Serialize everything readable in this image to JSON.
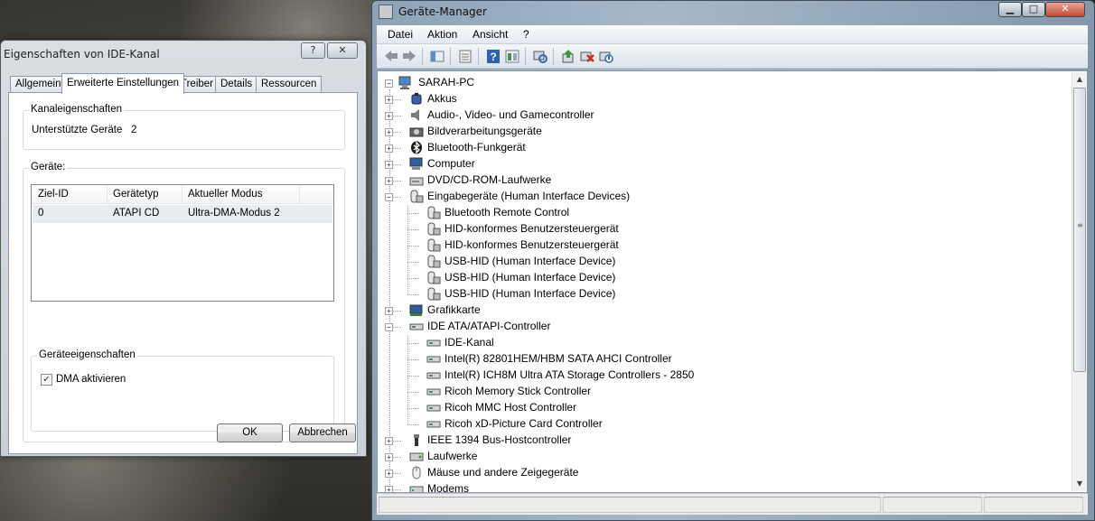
{
  "dialog": {
    "title": "Eigenschaften von IDE-Kanal",
    "help_button": "?",
    "close_button": "✕",
    "tabs": [
      {
        "label": "Allgemein",
        "active": false
      },
      {
        "label": "Erweiterte Einstellungen",
        "active": true
      },
      {
        "label": "Treiber",
        "active": false
      },
      {
        "label": "Details",
        "active": false
      },
      {
        "label": "Ressourcen",
        "active": false
      }
    ],
    "channel_group": {
      "title": "Kanaleigenschaften",
      "supported_label": "Unterstützte Geräte",
      "supported_value": "2"
    },
    "devices_group": {
      "title": "Geräte:",
      "columns": [
        "Ziel-ID",
        "Gerätetyp",
        "Aktueller Modus"
      ],
      "rows": [
        [
          "0",
          "ATAPI CD",
          "Ultra-DMA-Modus 2"
        ]
      ]
    },
    "device_props_group": {
      "title": "Geräteeigenschaften",
      "dma_label": "DMA aktivieren",
      "dma_checked": true,
      "check_mark": "✓"
    },
    "ok_label": "OK",
    "cancel_label": "Abbrechen"
  },
  "devmgr": {
    "title": "Geräte-Manager",
    "window_buttons": {
      "minimize": "▁",
      "maximize": "□",
      "close": "✕"
    },
    "menu": [
      "Datei",
      "Aktion",
      "Ansicht",
      "?"
    ],
    "toolbar_icons": [
      "back-icon",
      "forward-icon",
      "up-icon",
      "properties-icon",
      "help-icon",
      "view-icon",
      "scan-hardware-icon",
      "update-driver-icon",
      "uninstall-icon",
      "disable-icon"
    ],
    "tree": {
      "root": "SARAH-PC",
      "items": [
        {
          "label": "Akkus",
          "level": 1,
          "expander": "+",
          "icon": "battery-icon",
          "color": "#3a5fa8"
        },
        {
          "label": "Audio-, Video- und Gamecontroller",
          "level": 1,
          "expander": "+",
          "icon": "speaker-icon",
          "color": "#7a7a7a"
        },
        {
          "label": "Bildverarbeitungsgeräte",
          "level": 1,
          "expander": "+",
          "icon": "camera-icon",
          "color": "#666666"
        },
        {
          "label": "Bluetooth-Funkgerät",
          "level": 1,
          "expander": "+",
          "icon": "bluetooth-icon",
          "color": "#1c1c1c"
        },
        {
          "label": "Computer",
          "level": 1,
          "expander": "+",
          "icon": "computer-icon",
          "color": "#2d5fa0"
        },
        {
          "label": "DVD/CD-ROM-Laufwerke",
          "level": 1,
          "expander": "+",
          "icon": "dvd-drive-icon",
          "color": "#8a8a8a"
        },
        {
          "label": "Eingabegeräte (Human Interface Devices)",
          "level": 1,
          "expander": "−",
          "icon": "hid-icon",
          "color": "#8a8a8a"
        },
        {
          "label": "Bluetooth Remote Control",
          "level": 2,
          "expander": "",
          "icon": "hid-icon",
          "color": "#8a8a8a"
        },
        {
          "label": "HID-konformes Benutzersteuergerät",
          "level": 2,
          "expander": "",
          "icon": "hid-icon",
          "color": "#8a8a8a"
        },
        {
          "label": "HID-konformes Benutzersteuergerät",
          "level": 2,
          "expander": "",
          "icon": "hid-icon",
          "color": "#8a8a8a"
        },
        {
          "label": "USB-HID (Human Interface Device)",
          "level": 2,
          "expander": "",
          "icon": "hid-icon",
          "color": "#8a8a8a"
        },
        {
          "label": "USB-HID (Human Interface Device)",
          "level": 2,
          "expander": "",
          "icon": "hid-icon",
          "color": "#8a8a8a"
        },
        {
          "label": "USB-HID (Human Interface Device)",
          "level": 2,
          "expander": "",
          "icon": "hid-icon",
          "color": "#8a8a8a"
        },
        {
          "label": "Grafikkarte",
          "level": 1,
          "expander": "+",
          "icon": "display-adapter-icon",
          "color": "#2d5fa0"
        },
        {
          "label": "IDE ATA/ATAPI-Controller",
          "level": 1,
          "expander": "−",
          "icon": "ide-controller-icon",
          "color": "#5a8a5a"
        },
        {
          "label": "IDE-Kanal",
          "level": 2,
          "expander": "",
          "icon": "ide-controller-icon",
          "color": "#5a8a5a"
        },
        {
          "label": "Intel(R) 82801HEM/HBM SATA AHCI Controller",
          "level": 2,
          "expander": "",
          "icon": "ide-controller-icon",
          "color": "#5a8a5a"
        },
        {
          "label": "Intel(R) ICH8M Ultra ATA Storage Controllers - 2850",
          "level": 2,
          "expander": "",
          "icon": "ide-controller-icon",
          "color": "#5a8a5a"
        },
        {
          "label": "Ricoh Memory Stick Controller",
          "level": 2,
          "expander": "",
          "icon": "ide-controller-icon",
          "color": "#5a8a5a"
        },
        {
          "label": "Ricoh MMC Host Controller",
          "level": 2,
          "expander": "",
          "icon": "ide-controller-icon",
          "color": "#5a8a5a"
        },
        {
          "label": "Ricoh xD-Picture Card Controller",
          "level": 2,
          "expander": "",
          "icon": "ide-controller-icon",
          "color": "#5a8a5a"
        },
        {
          "label": "IEEE 1394 Bus-Hostcontroller",
          "level": 1,
          "expander": "+",
          "icon": "firewire-icon",
          "color": "#333333"
        },
        {
          "label": "Laufwerke",
          "level": 1,
          "expander": "+",
          "icon": "disk-drive-icon",
          "color": "#7a7a7a"
        },
        {
          "label": "Mäuse und andere Zeigegeräte",
          "level": 1,
          "expander": "+",
          "icon": "mouse-icon",
          "color": "#6a6a6a"
        },
        {
          "label": "Modems",
          "level": 1,
          "expander": "+",
          "icon": "modem-icon",
          "color": "#7a7a7a"
        }
      ]
    },
    "scrollbar": {
      "up": "▲",
      "down": "▼",
      "grip": "≡"
    }
  }
}
